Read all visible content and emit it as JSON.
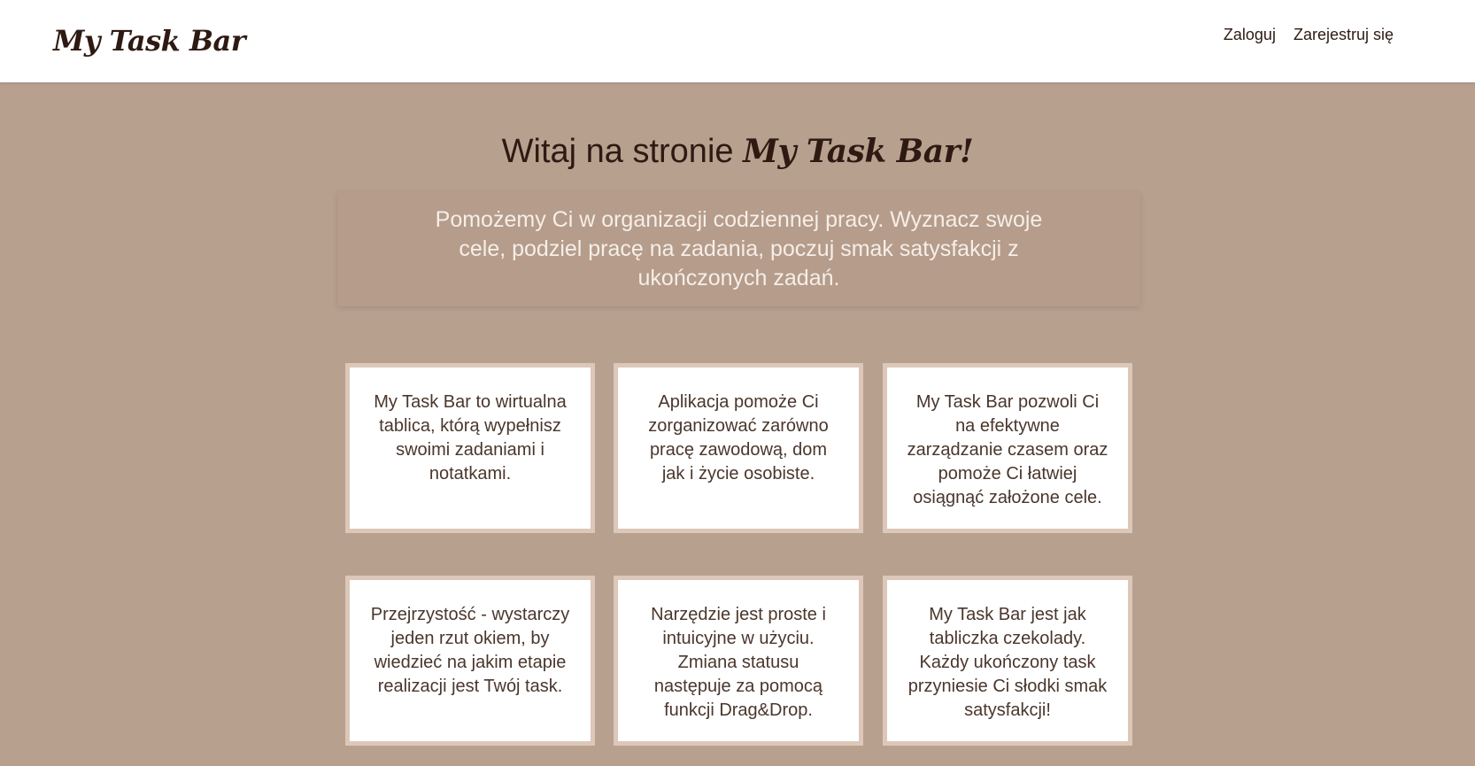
{
  "navbar": {
    "brand": "My Task Bar",
    "links": {
      "login": "Zaloguj",
      "register": "Zarejestruj się"
    }
  },
  "hero": {
    "title_prefix": "Witaj na stronie ",
    "title_brand": "My Task Bar!",
    "intro": "Pomożemy Ci w organizacji codziennej pracy. Wyznacz swoje cele, podziel pracę na zadania, poczuj smak satysfakcji z ukończonych zadań."
  },
  "features": [
    "My Task Bar to wirtualna tablica, którą wypełnisz swoimi zadaniami i notatkami.",
    "Aplikacja pomoże Ci zorganizować zarówno pracę zawodową, dom jak i życie osobiste.",
    "My Task Bar pozwoli Ci na efektywne zarządzanie czasem oraz pomoże Ci łatwiej osiągnąć założone cele.",
    "Przejrzystość - wystarczy jeden rzut okiem, by wiedzieć na jakim etapie realizacji jest Twój task.",
    "Narzędzie jest proste i intuicyjne w użyciu. Zmiana statusu następuje za pomocą funkcji Drag&Drop.",
    "My Task Bar jest jak tabliczka czekolady. Każdy ukończony task przyniesie Ci słodki smak satysfakcji!"
  ],
  "colors": {
    "background": "#b8a08f",
    "navbar": "#ffffff",
    "text_dark": "#2e1a12",
    "intro_box": "#b59c8b",
    "intro_text": "#f6eee8",
    "card_border": "#dcc7b9"
  }
}
